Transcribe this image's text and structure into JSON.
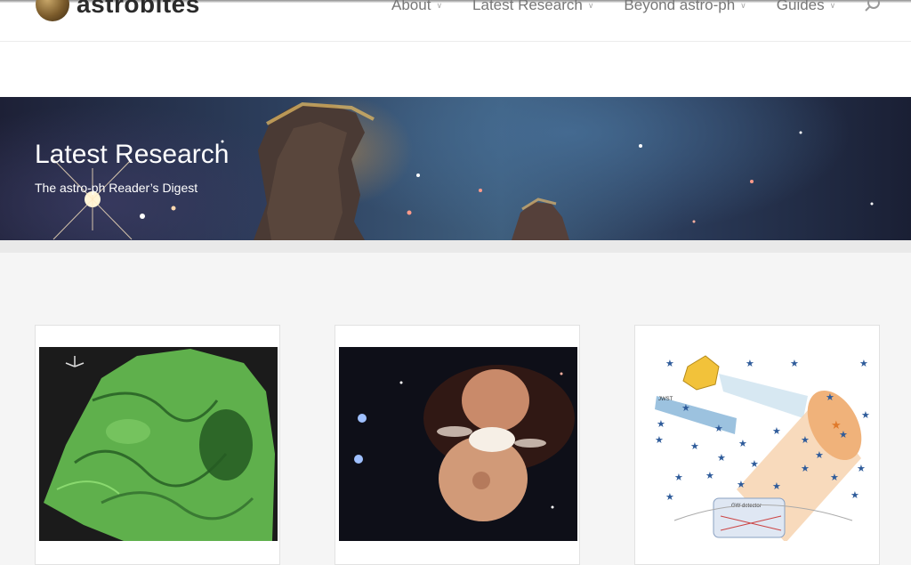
{
  "site": {
    "logo_text": "astrobites"
  },
  "nav": {
    "items": [
      {
        "label": "About"
      },
      {
        "label": "Latest Research"
      },
      {
        "label": "Beyond astro-ph"
      },
      {
        "label": "Guides"
      }
    ]
  },
  "hero": {
    "title": "Latest Research",
    "subtitle": "The astro-ph Reader’s Digest"
  },
  "cards": [
    {
      "image": "green-turbulent-simulation"
    },
    {
      "image": "eta-carinae-nebula"
    },
    {
      "image": "jwst-gw-detector-diagram",
      "jwst_label": "JWST",
      "gw_label": "GW detector"
    }
  ],
  "colors": {
    "nav_text": "#777777",
    "page_bg": "#f5f5f5",
    "star_blue": "#2e5b9a",
    "star_orange": "#e07a2b"
  }
}
